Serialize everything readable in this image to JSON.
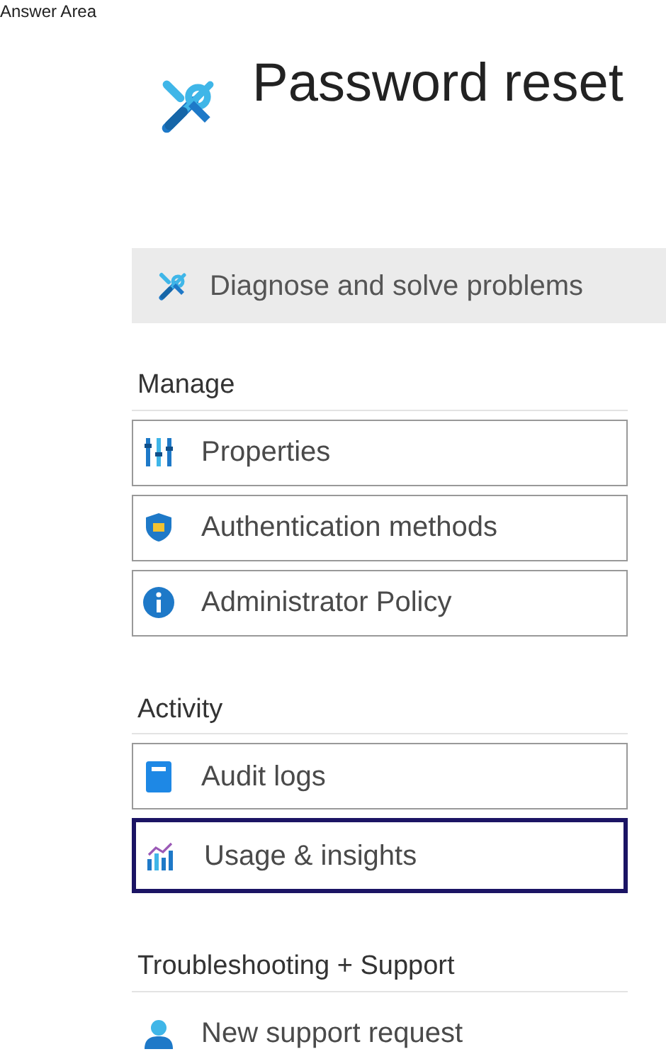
{
  "caption": "Answer Area",
  "blade": {
    "title": "Password reset"
  },
  "top_item": {
    "label": "Diagnose and solve problems",
    "kind": "tools",
    "highlighted": true
  },
  "sections": [
    {
      "heading": "Manage",
      "items": [
        {
          "label": "Properties",
          "kind": "properties",
          "boxed": true,
          "selected": false
        },
        {
          "label": "Authentication methods",
          "kind": "shield",
          "boxed": true,
          "selected": false
        },
        {
          "label": "Administrator Policy",
          "kind": "info",
          "boxed": true,
          "selected": false
        }
      ]
    },
    {
      "heading": "Activity",
      "items": [
        {
          "label": "Audit logs",
          "kind": "log",
          "boxed": true,
          "selected": false
        },
        {
          "label": "Usage & insights",
          "kind": "chart",
          "boxed": true,
          "selected": true
        }
      ]
    },
    {
      "heading": "Troubleshooting + Support",
      "items": [
        {
          "label": "New support request",
          "kind": "person",
          "boxed": false,
          "selected": false
        }
      ]
    }
  ]
}
